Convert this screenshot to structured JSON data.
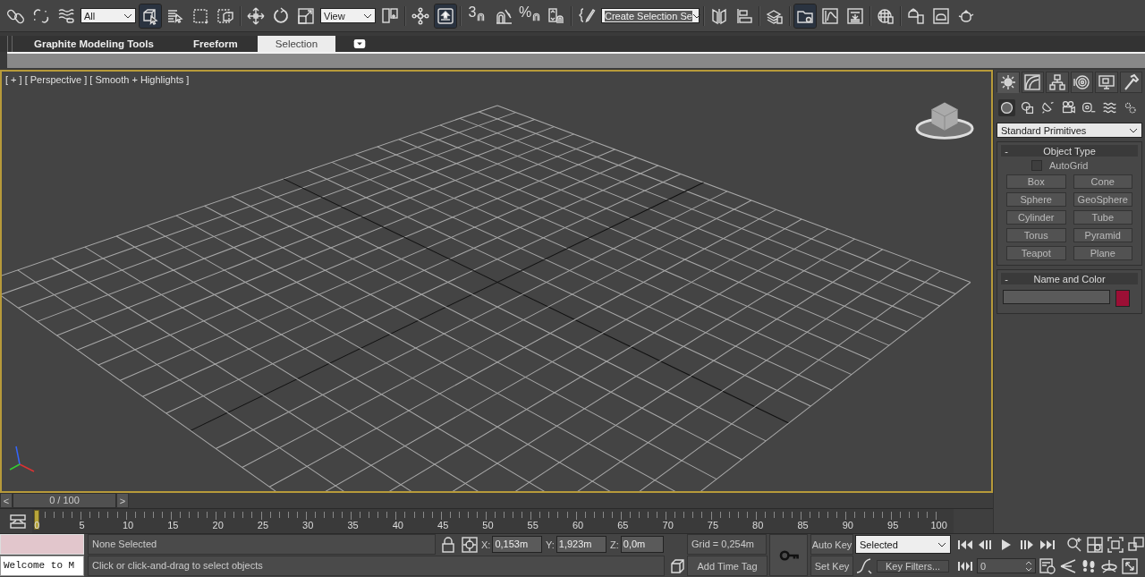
{
  "toolbar": {
    "items": [
      {
        "kind": "button",
        "active": false
      },
      {
        "kind": "button",
        "active": false
      },
      {
        "kind": "button",
        "active": false
      },
      {
        "kind": "dropdown",
        "value": "All"
      },
      {
        "kind": "button",
        "active": true
      },
      {
        "kind": "button",
        "active": false
      },
      {
        "kind": "button",
        "active": false
      },
      {
        "kind": "button",
        "active": false
      },
      {
        "kind": "separator"
      },
      {
        "kind": "button",
        "active": false
      },
      {
        "kind": "button",
        "active": false
      },
      {
        "kind": "button",
        "active": false
      },
      {
        "kind": "dropdown",
        "value": "View"
      },
      {
        "kind": "button",
        "active": false
      },
      {
        "kind": "separator"
      },
      {
        "kind": "button",
        "active": false
      },
      {
        "kind": "button",
        "active": true
      },
      {
        "kind": "separator"
      },
      {
        "kind": "snap",
        "label": "3"
      },
      {
        "kind": "button",
        "active": false
      },
      {
        "kind": "snap",
        "label": "%"
      },
      {
        "kind": "button",
        "active": false
      },
      {
        "kind": "separator"
      },
      {
        "kind": "button",
        "active": false
      },
      {
        "kind": "named_selection",
        "value": "Create Selection Se"
      },
      {
        "kind": "separator"
      },
      {
        "kind": "button",
        "active": false
      },
      {
        "kind": "button",
        "active": false
      },
      {
        "kind": "separator"
      },
      {
        "kind": "button",
        "active": false
      },
      {
        "kind": "separator"
      },
      {
        "kind": "button",
        "active": true
      },
      {
        "kind": "button",
        "active": false
      },
      {
        "kind": "button",
        "active": false
      },
      {
        "kind": "separator"
      },
      {
        "kind": "button",
        "active": false
      },
      {
        "kind": "separator"
      },
      {
        "kind": "button",
        "active": false
      },
      {
        "kind": "button",
        "active": false
      },
      {
        "kind": "button",
        "active": false
      }
    ]
  },
  "ribbon": {
    "tabs": [
      {
        "label": "Graphite Modeling Tools",
        "selected": false
      },
      {
        "label": "Freeform",
        "selected": false
      },
      {
        "label": "Selection",
        "selected": true
      }
    ]
  },
  "viewport": {
    "active": true,
    "labels": [
      "[ + ]",
      "[ Perspective ]",
      "[ Smooth + Highlights ]"
    ]
  },
  "command_panel": {
    "tabs": [
      {
        "selected": true
      },
      {
        "selected": false
      },
      {
        "selected": false
      },
      {
        "selected": false
      },
      {
        "selected": false
      },
      {
        "selected": false
      }
    ],
    "categories": [
      {
        "selected": true
      },
      {
        "selected": false
      },
      {
        "selected": false
      },
      {
        "selected": false
      },
      {
        "selected": false
      },
      {
        "selected": false
      },
      {
        "selected": false
      }
    ],
    "dropdown": "Standard Primitives",
    "object_type": {
      "toggle": "-",
      "title": "Object Type",
      "autogrid": {
        "label": "AutoGrid",
        "checked": false
      },
      "buttons": [
        "Box",
        "Cone",
        "Sphere",
        "GeoSphere",
        "Cylinder",
        "Tube",
        "Torus",
        "Pyramid",
        "Teapot",
        "Plane"
      ]
    },
    "name_and_color": {
      "toggle": "-",
      "title": "Name and Color",
      "color": "#9c0f35"
    }
  },
  "time_slider": {
    "prev": "<",
    "label": "0 / 100",
    "next": ">",
    "level": 0
  },
  "trackbar": {
    "level": 0,
    "labels": [
      "0",
      "5",
      "10",
      "15",
      "20",
      "25",
      "30",
      "35",
      "40",
      "45",
      "50",
      "55",
      "60",
      "65",
      "70",
      "75",
      "80",
      "85",
      "90",
      "95",
      "100"
    ]
  },
  "status": {
    "welcome": "Welcome to M",
    "selection": "None Selected",
    "prompt": "Click or click-and-drag to select objects",
    "x": {
      "label": "X:",
      "value": "0,153m"
    },
    "y": {
      "label": "Y:",
      "value": "1,923m"
    },
    "z": {
      "label": "Z:",
      "value": "0,0m"
    },
    "grid": "Grid = 0,254m",
    "time_tag": "Add Time Tag",
    "auto_key": {
      "label": "Auto Key",
      "on": false
    },
    "key_mode": "Selected",
    "set_key": "Set Key",
    "key_filters": "Key Filters...",
    "frame": "0"
  }
}
